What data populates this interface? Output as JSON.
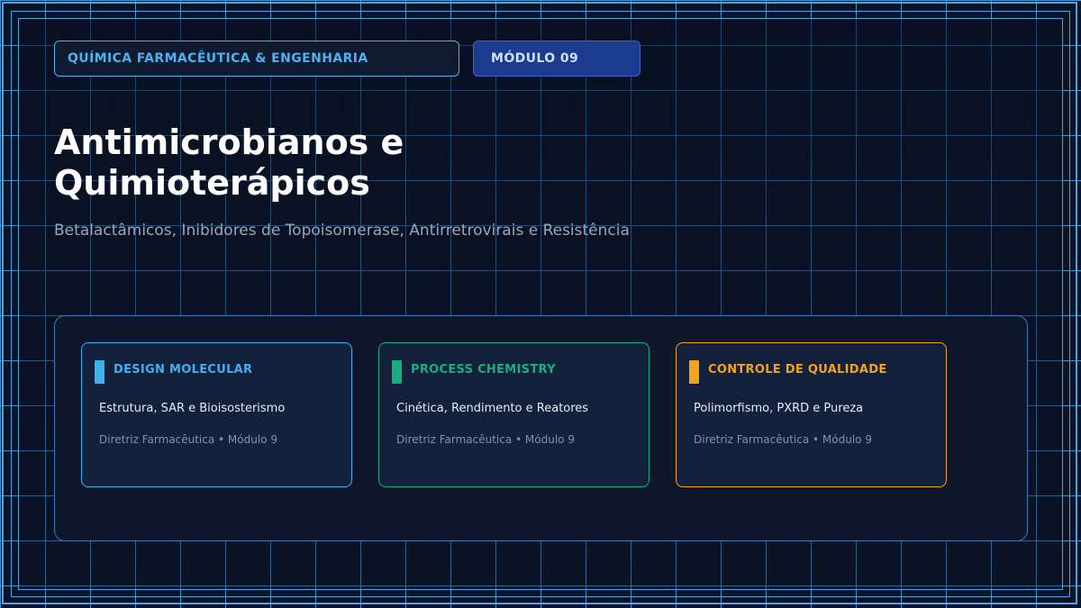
{
  "header": {
    "category": "QUÍMICA FARMACÊUTICA & ENGENHARIA",
    "module": "MÓDULO 09"
  },
  "title": {
    "line1": "Antimicrobianos e",
    "line2": "Quimioterápicos"
  },
  "subtitle": "Betalactâmicos, Inibidores de Topoisomerase, Antirretrovirais e Resistência",
  "cards": [
    {
      "title": "DESIGN MOLECULAR",
      "description": "Estrutura, SAR e Bioisosterismo",
      "footer": "Diretriz Farmacêutica • Módulo 9",
      "color": "#3db1f2"
    },
    {
      "title": "PROCESS CHEMISTRY",
      "description": "Cinética, Rendimento e Reatores",
      "footer": "Diretriz Farmacêutica • Módulo 9",
      "color": "#16b07f"
    },
    {
      "title": "CONTROLE DE QUALIDADE",
      "description": "Polimorfismo, PXRD e Pureza",
      "footer": "Diretriz Farmacêutica • Módulo 9",
      "color": "#f5a31c"
    }
  ],
  "colors": {
    "background": "#0b1327",
    "grid": "#4aa3e6",
    "panel": "#0e172b",
    "card": "#14213d"
  }
}
